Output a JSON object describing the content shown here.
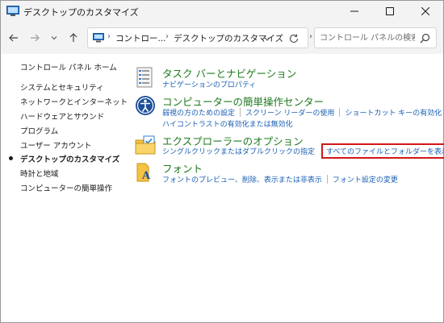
{
  "window": {
    "title": "デスクトップのカスタマイズ"
  },
  "address": {
    "crumbs": [
      "コントロー...",
      "デスクトップのカスタマイズ"
    ],
    "search_placeholder": "コントロール パネルの検索"
  },
  "sidebar": {
    "home": "コントロール パネル ホーム",
    "items": [
      {
        "label": "システムとセキュリティ",
        "active": false
      },
      {
        "label": "ネットワークとインターネット",
        "active": false
      },
      {
        "label": "ハードウェアとサウンド",
        "active": false
      },
      {
        "label": "プログラム",
        "active": false
      },
      {
        "label": "ユーザー アカウント",
        "active": false
      },
      {
        "label": "デスクトップのカスタマイズ",
        "active": true
      },
      {
        "label": "時計と地域",
        "active": false
      },
      {
        "label": "コンピューターの簡単操作",
        "active": false
      }
    ]
  },
  "categories": [
    {
      "title": "タスク バーとナビゲーション",
      "icon": "taskbar-icon",
      "links": [
        "ナビゲーションのプロパティ"
      ]
    },
    {
      "title": "コンピューターの簡単操作センター",
      "icon": "ease-of-access-icon",
      "links": [
        "弱視の方のための設定",
        "スクリーン リーダーの使用",
        "ショートカット キーの有効化"
      ],
      "links2": [
        "ハイコントラストの有効化または無効化"
      ]
    },
    {
      "title": "エクスプローラーのオプション",
      "icon": "folder-options-icon",
      "links": [
        "シングルクリックまたはダブルクリックの指定",
        "すべてのファイルとフォルダーを表示"
      ]
    },
    {
      "title": "フォント",
      "icon": "fonts-icon",
      "links": [
        "フォントのプレビュー、削除、表示または非表示",
        "フォント設定の変更"
      ]
    }
  ],
  "colors": {
    "category_title": "#1e7a1e",
    "link": "#1a5fb4",
    "highlight_border": "#d01818"
  }
}
